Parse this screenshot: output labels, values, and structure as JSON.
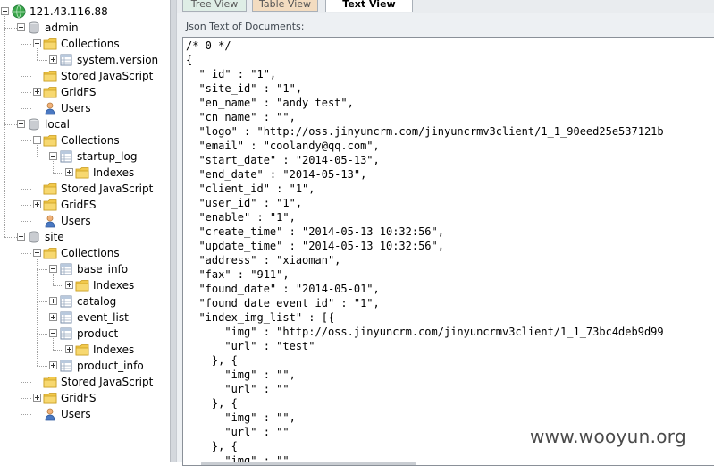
{
  "tree": {
    "server": "121.43.116.88",
    "nodes": [
      {
        "label": "admin",
        "type": "db"
      },
      {
        "label": "Collections",
        "type": "folder"
      },
      {
        "label": "system.version",
        "type": "collection"
      },
      {
        "label": "Stored JavaScript",
        "type": "folder"
      },
      {
        "label": "GridFS",
        "type": "folder"
      },
      {
        "label": "Users",
        "type": "users"
      },
      {
        "label": "local",
        "type": "db"
      },
      {
        "label": "Collections",
        "type": "folder"
      },
      {
        "label": "startup_log",
        "type": "collection"
      },
      {
        "label": "Indexes",
        "type": "folder"
      },
      {
        "label": "Stored JavaScript",
        "type": "folder"
      },
      {
        "label": "GridFS",
        "type": "folder"
      },
      {
        "label": "Users",
        "type": "users"
      },
      {
        "label": "site",
        "type": "db"
      },
      {
        "label": "Collections",
        "type": "folder"
      },
      {
        "label": "base_info",
        "type": "collection"
      },
      {
        "label": "Indexes",
        "type": "folder"
      },
      {
        "label": "catalog",
        "type": "collection"
      },
      {
        "label": "event_list",
        "type": "collection"
      },
      {
        "label": "product",
        "type": "collection"
      },
      {
        "label": "Indexes",
        "type": "folder"
      },
      {
        "label": "product_info",
        "type": "collection"
      },
      {
        "label": "Stored JavaScript",
        "type": "folder"
      },
      {
        "label": "GridFS",
        "type": "folder"
      },
      {
        "label": "Users",
        "type": "users"
      }
    ]
  },
  "tabs": {
    "tree_view": "Tree View",
    "table_view": "Table View",
    "text_view": "Text View"
  },
  "document": {
    "label": "Json Text of Documents:",
    "lines": [
      "/* 0 */",
      "{",
      "  \"_id\" : \"1\",",
      "  \"site_id\" : \"1\",",
      "  \"en_name\" : \"andy test\",",
      "  \"cn_name\" : \"\",",
      "  \"logo\" : \"http://oss.jinyuncrm.com/jinyuncrmv3client/1_1_90eed25e537121b",
      "  \"email\" : \"coolandy@qq.com\",",
      "  \"start_date\" : \"2014-05-13\",",
      "  \"end_date\" : \"2014-05-13\",",
      "  \"client_id\" : \"1\",",
      "  \"user_id\" : \"1\",",
      "  \"enable\" : \"1\",",
      "  \"create_time\" : \"2014-05-13 10:32:56\",",
      "  \"update_time\" : \"2014-05-13 10:32:56\",",
      "  \"address\" : \"xiaoman\",",
      "  \"fax\" : \"911\",",
      "  \"found_date\" : \"2014-05-01\",",
      "  \"found_date_event_id\" : \"1\",",
      "  \"index_img_list\" : [{",
      "      \"img\" : \"http://oss.jinyuncrm.com/jinyuncrmv3client/1_1_73bc4deb9d99",
      "      \"url\" : \"test\"",
      "    }, {",
      "      \"img\" : \"\",",
      "      \"url\" : \"\"",
      "    }, {",
      "      \"img\" : \"\",",
      "      \"url\" : \"\"",
      "    }, {",
      "      \"img\" : \"\","
    ]
  },
  "watermark": "www.wooyun.org",
  "colors": {
    "folder": "#f2c94c",
    "server_globe": "#3aa64a",
    "db": "#c9ccd1",
    "tab_active": "#ffffff",
    "tab_tree": "#dfeee6",
    "tab_table": "#f3dcc0"
  }
}
